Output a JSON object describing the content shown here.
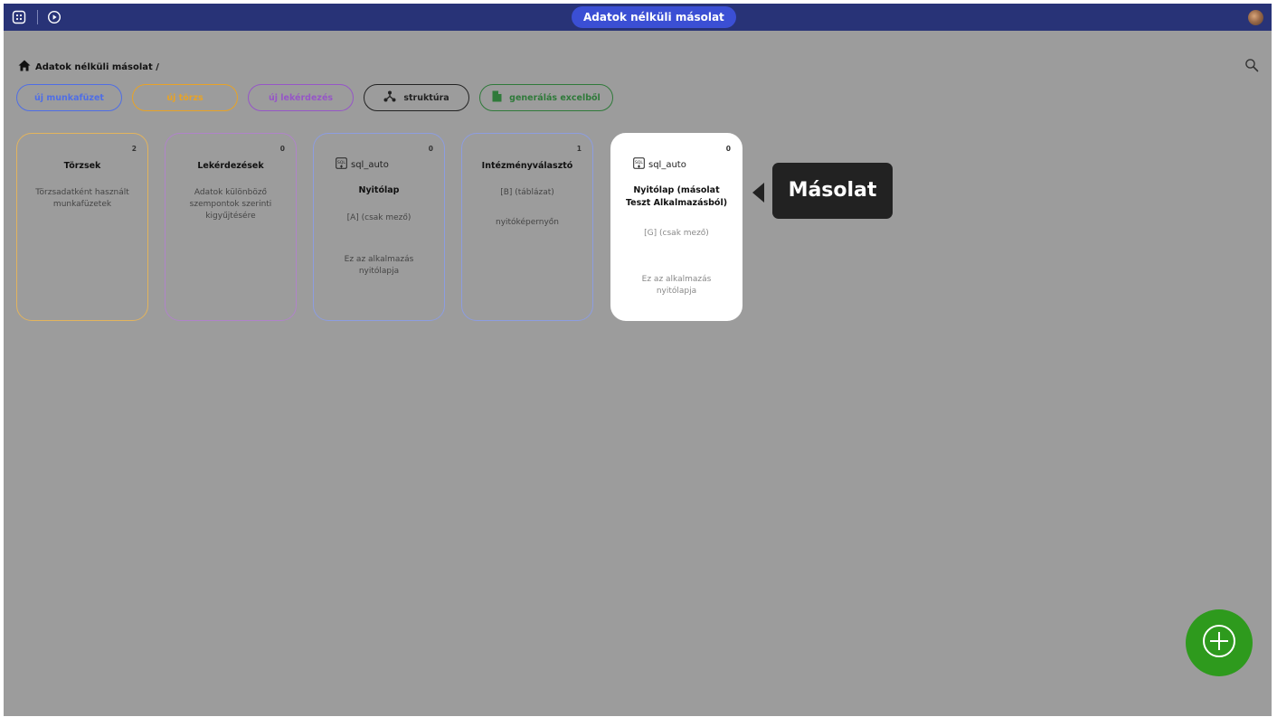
{
  "app": {
    "title": "Adatok nélküli másolat"
  },
  "topbar": {
    "icons": [
      "grid-icon",
      "play-icon"
    ],
    "avatar": "user-avatar"
  },
  "breadcrumb": {
    "home_icon": "home-icon",
    "path": "Adatok nélküli másolat /"
  },
  "search": {
    "icon": "search-icon"
  },
  "buttons": {
    "new_workbook": "új munkafüzet",
    "new_master": "új törzs",
    "new_query": "új lekérdezés",
    "structure": "struktúra",
    "generate_excel": "generálás excelből"
  },
  "cards": [
    {
      "title": "Törzsek",
      "count": "2",
      "desc": "Törzsadatként használt munkafüzetek"
    },
    {
      "title": "Lekérdezések",
      "count": "0",
      "desc": "Adatok különböző szempontok szerinti kigyűjtésére"
    },
    {
      "tag": "sql_auto",
      "title": "Nyitólap",
      "count": "0",
      "desc": "[A] (csak mező)",
      "desc2": "Ez az alkalmazás nyitólapja"
    },
    {
      "title": "Intézményválasztó",
      "count": "1",
      "desc": "[B] (táblázat)",
      "desc2": "nyitóképernyőn"
    },
    {
      "tag": "sql_auto",
      "title": "Nyitólap (másolat Teszt Alkalmazásból)",
      "count": "0",
      "desc": "[G] (csak mező)",
      "desc2": "Ez az alkalmazás nyitólapja"
    }
  ],
  "tooltip": {
    "text": "Másolat"
  },
  "fab": {
    "icon": "plus-circle-icon"
  },
  "colors": {
    "topbar": "#283377",
    "title_pill": "#3b4fd4",
    "blue": "#4f6ee6",
    "orange": "#e8a326",
    "purple": "#9656c7",
    "dark": "#222222",
    "green": "#2f7a3a",
    "card_torzsek": "#e3b45d",
    "card_lekerdezes": "#b083c9",
    "card_default": "#8d9de0",
    "fab": "#2e9a1d"
  }
}
